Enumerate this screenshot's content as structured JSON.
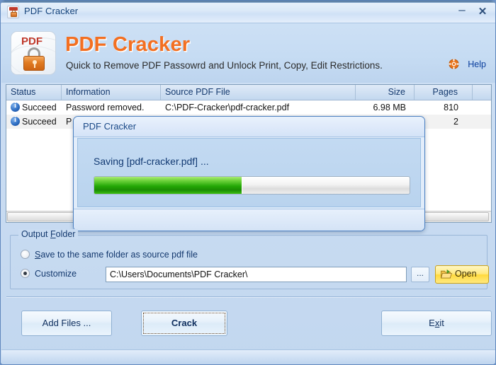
{
  "window": {
    "title": "PDF Cracker",
    "icon": "pdf-lock-icon",
    "minimize_label": "–",
    "close_label": "✕"
  },
  "banner": {
    "logo_text": "PDF",
    "app_title": "PDF Cracker",
    "subtitle": "Quick to Remove PDF  Passowrd and Unlock Print, Copy, Edit Restrictions.",
    "help_label": "Help",
    "help_icon": "lifering-icon",
    "title_color": "#f36f21"
  },
  "table": {
    "columns": [
      "Status",
      "Information",
      "Source PDF File",
      "Size",
      "Pages",
      ""
    ],
    "rows": [
      {
        "status": "Succeed",
        "status_icon": "info-icon",
        "information": "Password removed.",
        "source": "C:\\PDF-Cracker\\pdf-cracker.pdf",
        "size": "6.98 MB",
        "pages": "810"
      },
      {
        "status": "Succeed",
        "status_icon": "info-icon",
        "information": "P",
        "source": "",
        "size": "",
        "pages": "2"
      }
    ]
  },
  "dialog": {
    "title": "PDF Cracker",
    "message": "Saving [pdf-cracker.pdf] ...",
    "progress_percent": 47,
    "progress_color": "#23a806"
  },
  "output_folder": {
    "legend_pre": "Output ",
    "legend_key": "F",
    "legend_post": "older",
    "option_same_pre": "",
    "option_same_key": "S",
    "option_same_post": "ave to the same folder as source pdf file",
    "option_custom": "Customize",
    "selected": "Customize",
    "path_value": "C:\\Users\\Documents\\PDF Cracker\\",
    "browse_label": "...",
    "open_label": "Open",
    "open_icon": "open-folder-icon"
  },
  "footer": {
    "add_files_label": "Add Files ...",
    "crack_label": "Crack",
    "exit_pre": "E",
    "exit_key": "x",
    "exit_post": "it"
  }
}
